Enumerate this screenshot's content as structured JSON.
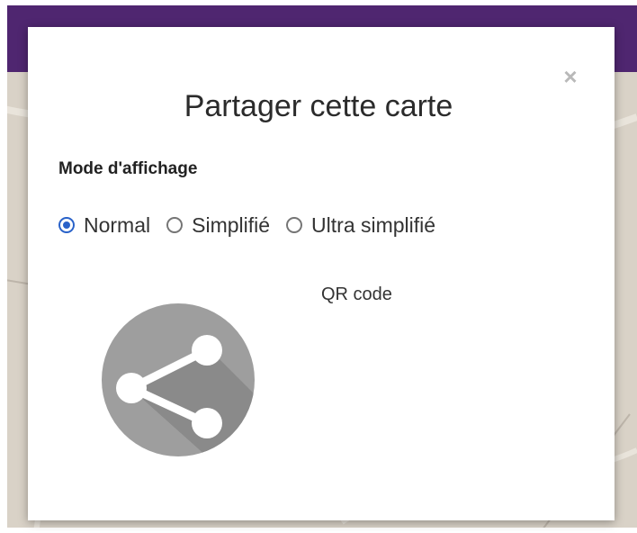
{
  "dialog": {
    "title": "Partager cette carte",
    "close_glyph": "×",
    "display_mode_label": "Mode d'affichage",
    "display_modes": [
      {
        "label": "Normal",
        "checked": true
      },
      {
        "label": "Simplifié",
        "checked": false
      },
      {
        "label": "Ultra simplifié",
        "checked": false
      }
    ],
    "qr_label": "QR code",
    "share_icon": "share-icon"
  },
  "colors": {
    "topbar": "#4f2670",
    "radio_accent": "#2962c9",
    "share_circle": "#9e9e9e"
  }
}
